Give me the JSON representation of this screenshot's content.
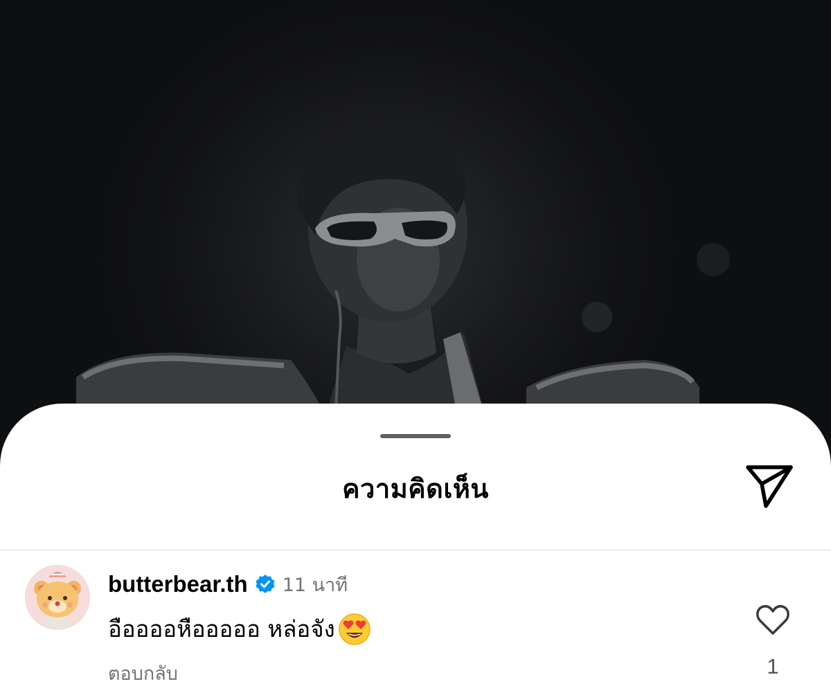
{
  "sheet": {
    "title": "ความคิดเห็น",
    "share_icon": "paper-plane-icon"
  },
  "comment": {
    "avatar_icon": "butter-bear-avatar",
    "username": "butterbear.th",
    "verified_icon": "verified-badge-icon",
    "time": "11 นาที",
    "text": "อืออออหือออออ หล่อจัง",
    "emoji_icon": "heart-eyes-emoji-icon",
    "reply_label": "ตอบกลับ",
    "like_icon": "heart-outline-icon",
    "like_count": "1"
  },
  "colors": {
    "sheet_background": "#ffffff",
    "secondary_text": "#737373",
    "verified_blue": "#0095f6",
    "divider": "#dbdbdb"
  }
}
